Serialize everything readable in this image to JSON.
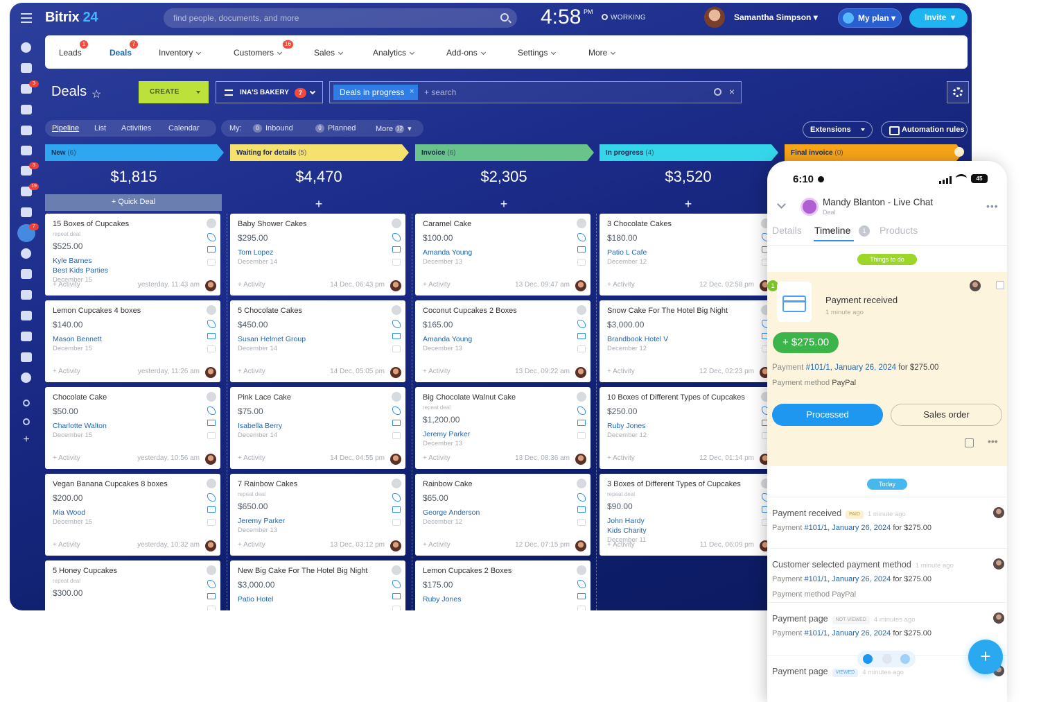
{
  "brand": {
    "name": "Bitrix",
    "version": "24"
  },
  "search": {
    "placeholder": "find people, documents, and more"
  },
  "clock": {
    "time": "4:58",
    "ampm": "PM",
    "status": "WORKING"
  },
  "user": {
    "name": "Samantha Simpson"
  },
  "header_buttons": {
    "my_plan": "My plan",
    "invite": "Invite"
  },
  "nav": [
    {
      "label": "Leads",
      "badge": "1"
    },
    {
      "label": "Deals",
      "badge": "7"
    },
    {
      "label": "Inventory",
      "badge": ""
    },
    {
      "label": "Customers",
      "badge": "16"
    },
    {
      "label": "Sales",
      "badge": ""
    },
    {
      "label": "Analytics",
      "badge": ""
    },
    {
      "label": "Add-ons",
      "badge": ""
    },
    {
      "label": "Settings",
      "badge": ""
    },
    {
      "label": "More",
      "badge": ""
    }
  ],
  "toolbar": {
    "title": "Deals",
    "create": "CREATE",
    "pipeline": "INA'S BAKERY",
    "pipeline_badge": "7",
    "filter_chip": "Deals in progress",
    "filter_placeholder": "+ search"
  },
  "view_tabs": [
    "Pipeline",
    "List",
    "Activities",
    "Calendar"
  ],
  "my_tabs": {
    "label": "My:",
    "inbound": "Inbound",
    "inbound_count": "0",
    "planned": "Planned",
    "planned_count": "0",
    "more": "More",
    "more_count": "12"
  },
  "right_buttons": {
    "extensions": "Extensions",
    "automation": "Automation rules"
  },
  "rail_badges": {
    "chat": "3",
    "calendar": "3",
    "tasks": "19",
    "sites": "7"
  },
  "quick_deal": "+ Quick Deal",
  "columns": [
    {
      "name": "New",
      "count": "(6)",
      "sum": "$1,815",
      "color": "#2fa6f0",
      "cards": [
        {
          "title": "15 Boxes of Cupcakes",
          "repeat": "repeat deal",
          "amount": "$525.00",
          "contact": "Kyle Barnes",
          "company": "Best Kids Parties",
          "date": "December 15",
          "activity": "+ Activity",
          "when": "yesterday, 11:43 am"
        },
        {
          "title": "Lemon Cupcakes 4 boxes",
          "repeat": "",
          "amount": "$140.00",
          "contact": "Mason Bennett",
          "company": "",
          "date": "December 15",
          "activity": "+ Activity",
          "when": "yesterday, 11:26 am"
        },
        {
          "title": "Chocolate Cake",
          "repeat": "",
          "amount": "$50.00",
          "contact": "Charlotte Walton",
          "company": "",
          "date": "December 15",
          "activity": "+ Activity",
          "when": "yesterday, 10:56 am"
        },
        {
          "title": "Vegan Banana Cupcakes 8 boxes",
          "repeat": "",
          "amount": "$200.00",
          "contact": "Mia Wood",
          "company": "",
          "date": "December 15",
          "activity": "+ Activity",
          "when": "yesterday, 10:32 am"
        },
        {
          "title": "5 Honey Cupcakes",
          "repeat": "repeat deal",
          "amount": "$300.00",
          "contact": "",
          "company": "",
          "date": "",
          "activity": "",
          "when": ""
        }
      ]
    },
    {
      "name": "Waiting for details",
      "count": "(5)",
      "sum": "$4,470",
      "color": "#f5e16d",
      "cards": [
        {
          "title": "Baby Shower Cakes",
          "repeat": "",
          "amount": "$295.00",
          "contact": "Tom Lopez",
          "company": "",
          "date": "December 14",
          "activity": "+ Activity",
          "when": "14 Dec, 06:43 pm"
        },
        {
          "title": "5 Chocolate Cakes",
          "repeat": "",
          "amount": "$450.00",
          "contact": "Susan Helmet Group",
          "company": "",
          "date": "December 14",
          "activity": "+ Activity",
          "when": "14 Dec, 05:05 pm"
        },
        {
          "title": "Pink Lace Cake",
          "repeat": "",
          "amount": "$75.00",
          "contact": "Isabella Berry",
          "company": "",
          "date": "December 14",
          "activity": "+ Activity",
          "when": "14 Dec, 04:55 pm"
        },
        {
          "title": "7 Rainbow Cakes",
          "repeat": "repeat deal",
          "amount": "$650.00",
          "contact": "Jeremy Parker",
          "company": "",
          "date": "December 13",
          "activity": "+ Activity",
          "when": "13 Dec, 03:12 pm"
        },
        {
          "title": "New Big Cake For The Hotel Big Night",
          "repeat": "",
          "amount": "$3,000.00",
          "contact": "Patio Hotel",
          "company": "",
          "date": "",
          "activity": "",
          "when": ""
        }
      ]
    },
    {
      "name": "Invoice",
      "count": "(6)",
      "sum": "$2,305",
      "color": "#68c48a",
      "cards": [
        {
          "title": "Caramel Cake",
          "repeat": "",
          "amount": "$100.00",
          "contact": "Amanda Young",
          "company": "",
          "date": "December 13",
          "activity": "+ Activity",
          "when": "13 Dec, 09:47 am"
        },
        {
          "title": "Coconut Cupcakes 2 Boxes",
          "repeat": "",
          "amount": "$165.00",
          "contact": "Amanda Young",
          "company": "",
          "date": "December 13",
          "activity": "+ Activity",
          "when": "13 Dec, 09:22 am"
        },
        {
          "title": "Big Chocolate Walnut Cake",
          "repeat": "repeat deal",
          "amount": "$1,200.00",
          "contact": "Jeremy Parker",
          "company": "",
          "date": "December 13",
          "activity": "+ Activity",
          "when": "13 Dec, 08:36 am"
        },
        {
          "title": "Rainbow Cake",
          "repeat": "",
          "amount": "$65.00",
          "contact": "George Anderson",
          "company": "",
          "date": "December 12",
          "activity": "+ Activity",
          "when": "12 Dec, 07:15 pm"
        },
        {
          "title": "Lemon Cupcakes 2 Boxes",
          "repeat": "",
          "amount": "$175.00",
          "contact": "Ruby Jones",
          "company": "",
          "date": "",
          "activity": "",
          "when": ""
        }
      ]
    },
    {
      "name": "In progress",
      "count": "(4)",
      "sum": "$3,520",
      "color": "#35d6ea",
      "cards": [
        {
          "title": "3 Chocolate Cakes",
          "repeat": "",
          "amount": "$180.00",
          "contact": "Patio L Cafe",
          "company": "",
          "date": "December 12",
          "activity": "+ Activity",
          "when": "12 Dec, 02:58 pm"
        },
        {
          "title": "Snow Cake For The Hotel Big Night",
          "repeat": "",
          "amount": "$3,000.00",
          "contact": "Brandbook Hotel V",
          "company": "",
          "date": "December 12",
          "activity": "+ Activity",
          "when": "12 Dec, 02:23 pm"
        },
        {
          "title": "10 Boxes of Different Types of Cupcakes",
          "repeat": "",
          "amount": "$250.00",
          "contact": "Ruby Jones",
          "company": "",
          "date": "December 12",
          "activity": "+ Activity",
          "when": "12 Dec, 01:14 pm"
        },
        {
          "title": "3 Boxes of Different Types of Cupcakes",
          "repeat": "repeat deal",
          "amount": "$90.00",
          "contact": "John Hardy",
          "company": "Kids Charity",
          "date": "December 11",
          "activity": "+ Activity",
          "when": "11 Dec, 06:09 pm"
        }
      ]
    },
    {
      "name": "Final invoice",
      "count": "(0)",
      "sum": "",
      "color": "#f8a51a",
      "cards": []
    }
  ],
  "phone": {
    "time": "6:10",
    "battery": "45",
    "chat_title": "Mandy Blanton - Live Chat",
    "chat_sub": "Deal",
    "tabs": [
      "Details",
      "Timeline",
      "Products"
    ],
    "timeline_badge": "1",
    "things_to_do": "Things to do",
    "todo": {
      "count": "1",
      "title": "Payment received",
      "ago": "1 minute ago",
      "amount": "+ $275.00",
      "payment_label": "Payment",
      "payment_link": "#101/1, January 26, 2024",
      "payment_for": "for $275.00",
      "method_label": "Payment method",
      "method_value": "PayPal",
      "processed": "Processed",
      "sales_order": "Sales order"
    },
    "today": "Today",
    "history": [
      {
        "title": "Payment received",
        "tag": "PAID",
        "ago": "1 minute ago",
        "line1_label": "Payment",
        "line1_link": "#101/1, January 26, 2024",
        "line1_for": "for $275.00",
        "line2": ""
      },
      {
        "title": "Customer selected payment method",
        "tag": "",
        "ago": "1 minute ago",
        "line1_label": "Payment",
        "line1_link": "#101/1, January 26, 2024",
        "line1_for": "for $275.00",
        "line2": "Payment method PayPal"
      },
      {
        "title": "Payment page",
        "tag": "NOT VIEWED",
        "ago": "4 minutes ago",
        "line1_label": "Payment",
        "line1_link": "#101/1, January 26, 2024",
        "line1_for": "for $275.00",
        "line2": ""
      },
      {
        "title": "Payment page",
        "tag": "VIEWED",
        "ago": "4 minutes ago",
        "line1_label": "",
        "line1_link": "",
        "line1_for": "",
        "line2": ""
      }
    ]
  },
  "colors": {
    "accent": "#2f8ef0",
    "create": "#bbe13a",
    "invite": "#1fb5f0",
    "danger": "#f24b3e"
  }
}
